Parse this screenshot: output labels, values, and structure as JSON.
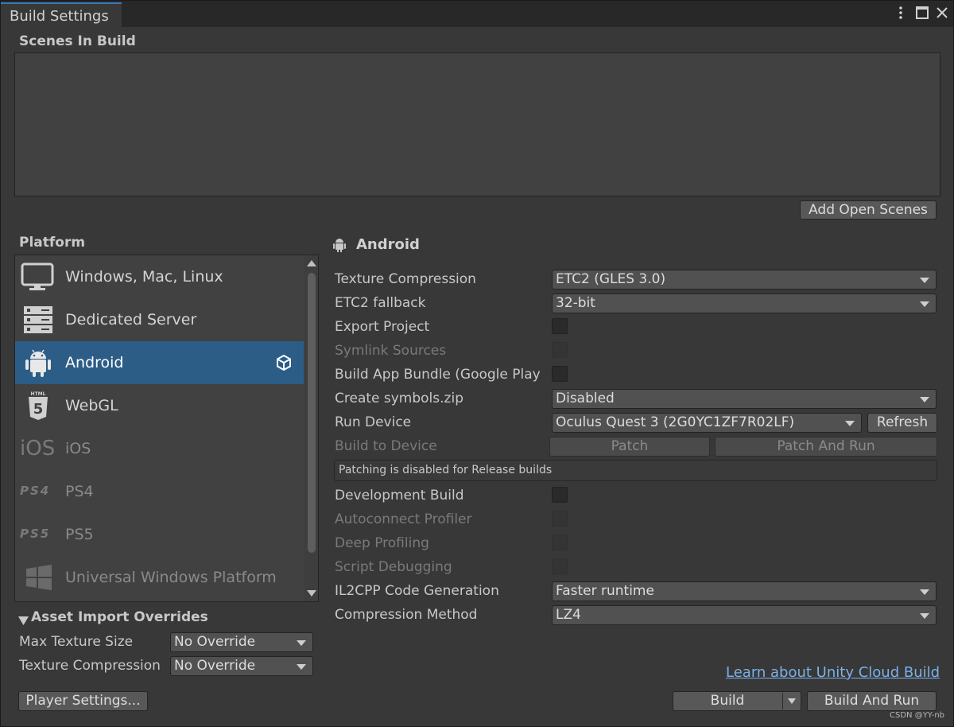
{
  "window": {
    "tab_title": "Build Settings",
    "menu_icon": "kebab-menu-icon",
    "maximize_icon": "maximize-icon",
    "close_icon": "close-icon"
  },
  "scenes": {
    "title": "Scenes In Build",
    "add_open_scenes_label": "Add Open Scenes"
  },
  "platform": {
    "title": "Platform",
    "items": [
      {
        "label": "Windows, Mac, Linux",
        "icon": "monitor-icon",
        "enabled": true
      },
      {
        "label": "Dedicated Server",
        "icon": "server-icon",
        "enabled": true
      },
      {
        "label": "Android",
        "icon": "android-icon",
        "enabled": true,
        "selected": true,
        "badge_icon": "unity-logo-icon"
      },
      {
        "label": "WebGL",
        "icon": "html5-icon",
        "enabled": true
      },
      {
        "label": "iOS",
        "icon": "ios-icon",
        "icon_text": "iOS",
        "enabled": false
      },
      {
        "label": "PS4",
        "icon": "ps4-icon",
        "icon_text": "PS4",
        "enabled": false
      },
      {
        "label": "PS5",
        "icon": "ps5-icon",
        "icon_text": "PS5",
        "enabled": false
      },
      {
        "label": "Universal Windows Platform",
        "icon": "windows-logo-icon",
        "enabled": false
      }
    ]
  },
  "asset_import": {
    "title": "Asset Import Overrides",
    "max_texture_size_label": "Max Texture Size",
    "max_texture_size_value": "No Override",
    "texture_compression_label": "Texture Compression",
    "texture_compression_value": "No Override"
  },
  "settings": {
    "title": "Android",
    "texture_compression_label": "Texture Compression",
    "texture_compression_value": "ETC2 (GLES 3.0)",
    "etc2_fallback_label": "ETC2 fallback",
    "etc2_fallback_value": "32-bit",
    "export_project_label": "Export Project",
    "symlink_sources_label": "Symlink Sources",
    "build_app_bundle_label": "Build App Bundle (Google Play",
    "create_symbols_label": "Create symbols.zip",
    "create_symbols_value": "Disabled",
    "run_device_label": "Run Device",
    "run_device_value": "Oculus Quest 3 (2G0YC1ZF7R02LF)",
    "refresh_label": "Refresh",
    "build_to_device_label": "Build to Device",
    "patch_label": "Patch",
    "patch_and_run_label": "Patch And Run",
    "patch_note": "Patching is disabled for Release builds",
    "development_build_label": "Development Build",
    "autoconnect_profiler_label": "Autoconnect Profiler",
    "deep_profiling_label": "Deep Profiling",
    "script_debugging_label": "Script Debugging",
    "il2cpp_label": "IL2CPP Code Generation",
    "il2cpp_value": "Faster runtime",
    "compression_label": "Compression Method",
    "compression_value": "LZ4"
  },
  "footer": {
    "cloud_build_link": "Learn about Unity Cloud Build",
    "player_settings_label": "Player Settings...",
    "build_label": "Build",
    "build_and_run_label": "Build And Run"
  },
  "watermark": "CSDN @YY-nb",
  "colors": {
    "panel": "#383838",
    "selection": "#2c5d87",
    "accent_tab": "#3a79bb",
    "link": "#7bb0e8"
  }
}
